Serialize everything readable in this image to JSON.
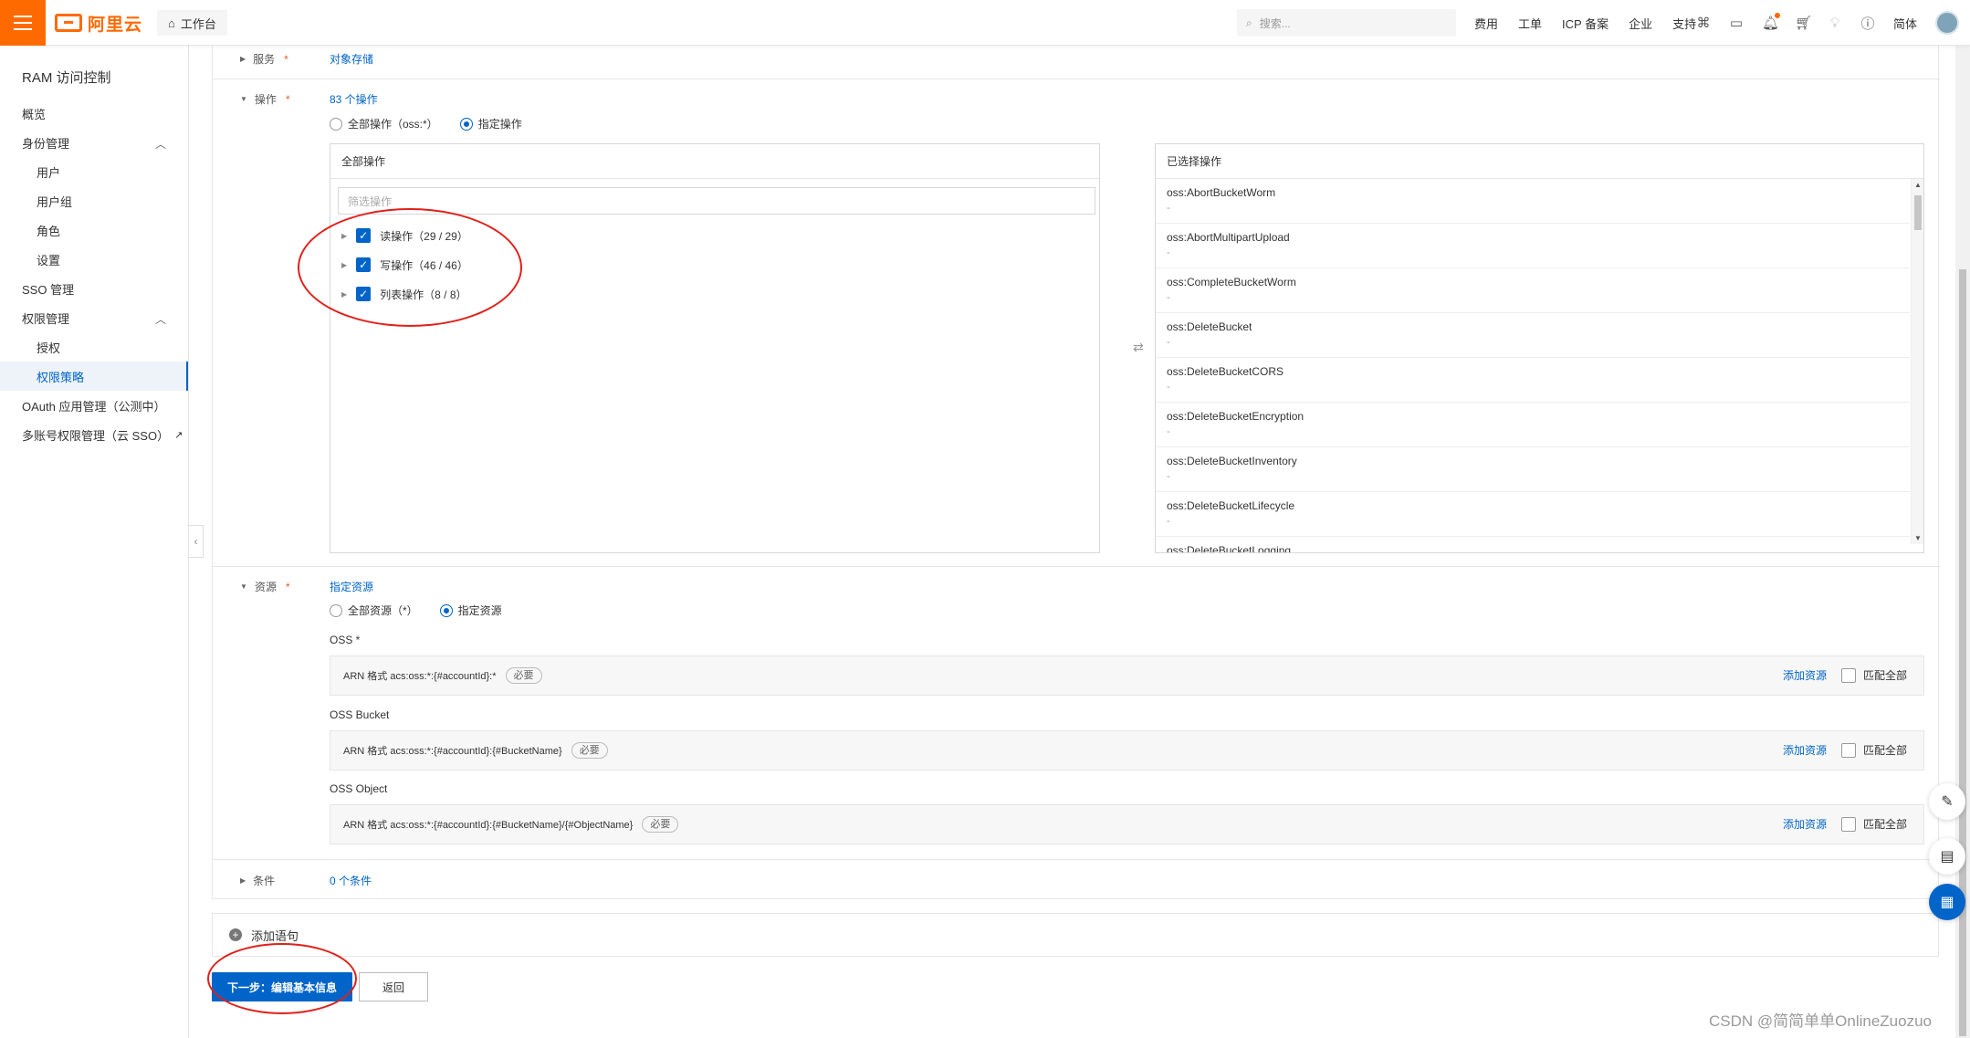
{
  "topbar": {
    "logo_text": "阿里云",
    "workbench": "工作台",
    "search_placeholder": "搜索...",
    "nav": [
      "费用",
      "工单",
      "ICP 备案",
      "企业",
      "支持"
    ],
    "lang": "简体",
    "icons": [
      "code-icon",
      "terminal-icon",
      "bell-icon",
      "cart-icon",
      "bulb-icon",
      "help-icon"
    ]
  },
  "sidebar": {
    "title": "RAM 访问控制",
    "items": [
      {
        "label": "概览"
      },
      {
        "label": "身份管理"
      },
      {
        "label": "用户"
      },
      {
        "label": "用户组"
      },
      {
        "label": "角色"
      },
      {
        "label": "设置"
      },
      {
        "label": "SSO 管理"
      },
      {
        "label": "权限管理"
      },
      {
        "label": "授权"
      },
      {
        "label": "权限策略"
      },
      {
        "label": "OAuth 应用管理（公测中）"
      },
      {
        "label": "多账号权限管理（云 SSO）"
      }
    ]
  },
  "policy": {
    "service": {
      "label": "服务",
      "value": "对象存储"
    },
    "actions": {
      "label": "操作",
      "value": "83 个操作",
      "radio_all": "全部操作（oss:*）",
      "radio_specified": "指定操作",
      "left_title": "全部操作",
      "filter_placeholder": "筛选操作",
      "groups": [
        {
          "label": "读操作（29 / 29）"
        },
        {
          "label": "写操作（46 / 46）"
        },
        {
          "label": "列表操作（8 / 8）"
        }
      ],
      "right_title": "已选择操作",
      "selected": [
        {
          "name": "oss:AbortBucketWorm",
          "desc": "-"
        },
        {
          "name": "oss:AbortMultipartUpload",
          "desc": "-"
        },
        {
          "name": "oss:CompleteBucketWorm",
          "desc": "-"
        },
        {
          "name": "oss:DeleteBucket",
          "desc": "-"
        },
        {
          "name": "oss:DeleteBucketCORS",
          "desc": "-"
        },
        {
          "name": "oss:DeleteBucketEncryption",
          "desc": "-"
        },
        {
          "name": "oss:DeleteBucketInventory",
          "desc": "-"
        },
        {
          "name": "oss:DeleteBucketLifecycle",
          "desc": "-"
        },
        {
          "name": "oss:DeleteBucketLogging",
          "desc": ""
        }
      ]
    },
    "resources": {
      "label": "资源",
      "value": "指定资源",
      "radio_all": "全部资源（*）",
      "radio_specified": "指定资源",
      "groups": [
        {
          "title": "OSS *",
          "arn": "ARN 格式 acs:oss:*:{#accountId}:*",
          "pill": "必要",
          "add": "添加资源",
          "match_all": "匹配全部"
        },
        {
          "title": "OSS Bucket",
          "arn": "ARN 格式 acs:oss:*:{#accountId}:{#BucketName}",
          "pill": "必要",
          "add": "添加资源",
          "match_all": "匹配全部"
        },
        {
          "title": "OSS Object",
          "arn": "ARN 格式 acs:oss:*:{#accountId}:{#BucketName}/{#ObjectName}",
          "pill": "必要",
          "add": "添加资源",
          "match_all": "匹配全部"
        }
      ]
    },
    "conditions": {
      "label": "条件",
      "value": "0 个条件"
    },
    "add_statement": "添加语句",
    "next_button": "下一步：编辑基本信息",
    "back_button": "返回"
  },
  "watermark": "CSDN @简简单单OnlineZuozuo",
  "colors": {
    "brand": "#ff6a00",
    "primary": "#0064c8",
    "annotation": "#e0201a"
  }
}
